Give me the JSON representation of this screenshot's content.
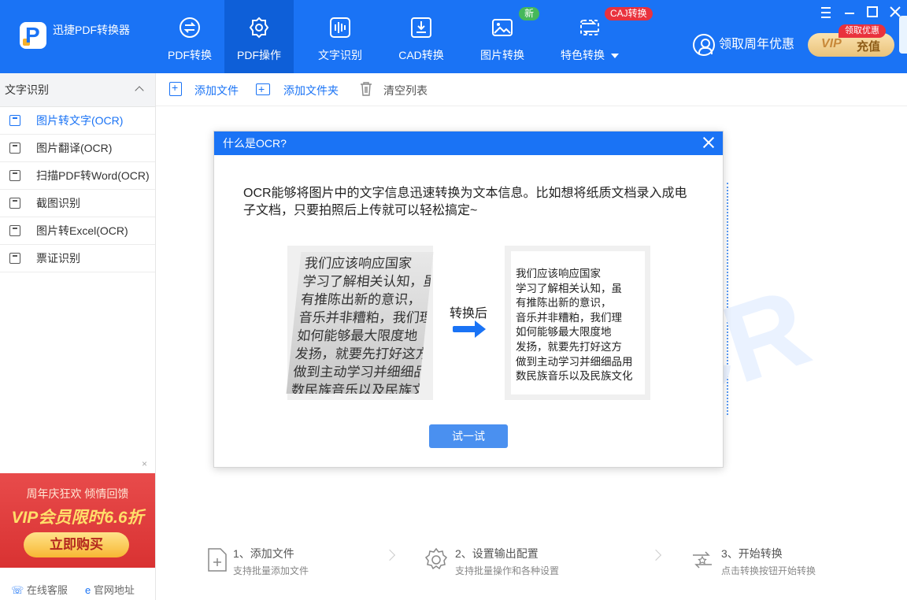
{
  "app": {
    "name": "迅捷PDF转换器"
  },
  "nav": {
    "tabs": [
      {
        "label": "PDF转换",
        "icon": "pdf-convert-icon"
      },
      {
        "label": "PDF操作",
        "icon": "pdf-operate-icon"
      },
      {
        "label": "文字识别",
        "icon": "text-recognition-icon"
      },
      {
        "label": "CAD转换",
        "icon": "cad-convert-icon"
      },
      {
        "label": "图片转换",
        "icon": "image-convert-icon"
      },
      {
        "label": "特色转换",
        "icon": "feature-convert-icon"
      }
    ],
    "active_tab": "PDF操作",
    "badge_new": "新",
    "badge_caj": "CAJ转换"
  },
  "header": {
    "promo_text": "领取周年优惠",
    "vip_label": "VIP",
    "vip_action": "充值",
    "vip_badge": "领取优惠"
  },
  "sidebar": {
    "title": "文字识别",
    "items": [
      {
        "label": "图片转文字(OCR)"
      },
      {
        "label": "图片翻译(OCR)"
      },
      {
        "label": "扫描PDF转Word(OCR)"
      },
      {
        "label": "截图识别"
      },
      {
        "label": "图片转Excel(OCR)"
      },
      {
        "label": "票证识别"
      }
    ],
    "active_item": "图片转文字(OCR)",
    "ad": {
      "line1": "周年庆狂欢 倾情回馈",
      "line2": "VIP会员限时6.6折",
      "button": "立即购买",
      "close": "×"
    },
    "footer": {
      "service": "在线客服",
      "website": "官网地址"
    }
  },
  "toolbar": {
    "add_file": "添加文件",
    "add_folder": "添加文件夹",
    "clear_list": "清空列表"
  },
  "watermark": "OCR",
  "dialog": {
    "title": "什么是OCR?",
    "description": "OCR能够将图片中的文字信息迅速转换为文本信息。比如想将纸质文档录入成电子文档，只要拍照后上传就可以轻松搞定~",
    "handwriting_lines": [
      "我们应该响应国家",
      "学习了解相关认知，虽",
      "有推陈出新的意识，",
      "音乐并非糟粕，我们理",
      "如何能够最大限度地",
      "发扬，就要先打好这方",
      "做到主动学习并细细品用",
      "数民族音乐以及民族文化"
    ],
    "arrow_label": "转换后",
    "output_lines": [
      "我们应该响应国家",
      "学习了解相关认知，虽",
      "有推陈出新的意识，",
      "音乐并非糟粕，我们理",
      "如何能够最大限度地",
      "发扬，就要先打好这方",
      "做到主动学习并细细品用",
      "数民族音乐以及民族文化"
    ],
    "try_button": "试一试"
  },
  "steps": [
    {
      "title": "1、添加文件",
      "sub": "支持批量添加文件"
    },
    {
      "title": "2、设置输出配置",
      "sub": "支持批量操作和各种设置"
    },
    {
      "title": "3、开始转换",
      "sub": "点击转换按钮开始转换"
    }
  ],
  "colors": {
    "primary": "#1a73f5",
    "active_tab": "#0e5fd8",
    "badge_new": "#46b85a",
    "badge_caj": "#e9323d",
    "ad_bg": "#d93232"
  }
}
